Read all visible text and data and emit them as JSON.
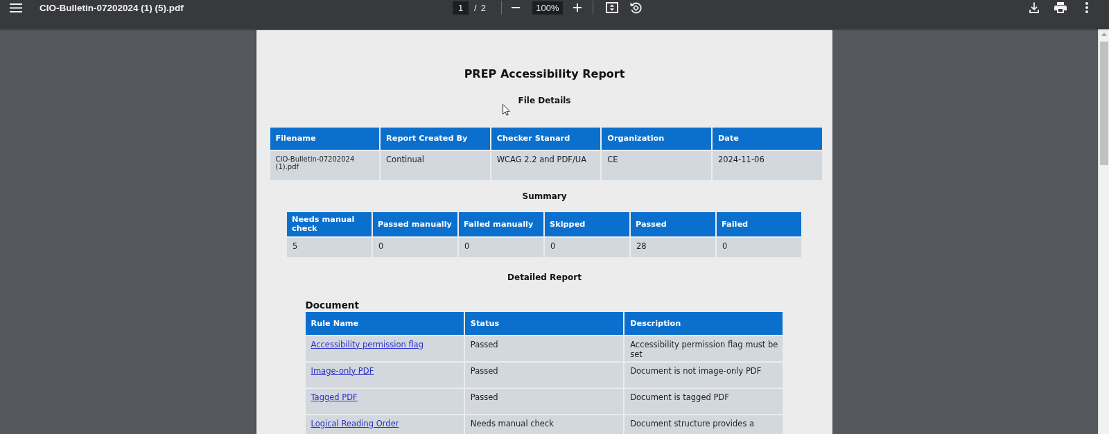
{
  "toolbar": {
    "title": "CIO-Bulletin-07202024 (1) (5).pdf",
    "page_number": "1",
    "page_separator": "/",
    "page_total": "2",
    "zoom": "100%"
  },
  "report": {
    "title": "PREP Accessibility Report",
    "file_details": {
      "title": "File Details",
      "columns": [
        "Filename",
        "Report Created By",
        "Checker Stanard",
        "Organization",
        "Date"
      ],
      "rows": [
        [
          "CIO-Bulletin-07202024 (1).pdf",
          "Continual",
          "WCAG 2.2 and PDF/UA",
          "CE",
          "2024-11-06"
        ]
      ]
    },
    "summary": {
      "title": "Summary",
      "columns": [
        "Needs manual check",
        "Passed manually",
        "Failed manually",
        "Skipped",
        "Passed",
        "Failed"
      ],
      "rows": [
        [
          "5",
          "0",
          "0",
          "0",
          "28",
          "0"
        ]
      ]
    },
    "detailed_report": {
      "title": "Detailed Report",
      "sections": [
        {
          "title": "Document",
          "columns": [
            "Rule Name",
            "Status",
            "Description"
          ],
          "rows": [
            {
              "rule_name": "Accessibility permission flag",
              "status": "Passed",
              "description": "Accessibility permission flag must be set"
            },
            {
              "rule_name": "Image-only PDF",
              "status": "Passed",
              "description": "Document is not image-only PDF"
            },
            {
              "rule_name": "Tagged PDF",
              "status": "Passed",
              "description": "Document is tagged PDF"
            },
            {
              "rule_name": "Logical Reading Order",
              "status": "Needs manual check",
              "description": "Document structure provides a"
            }
          ]
        }
      ]
    }
  }
}
